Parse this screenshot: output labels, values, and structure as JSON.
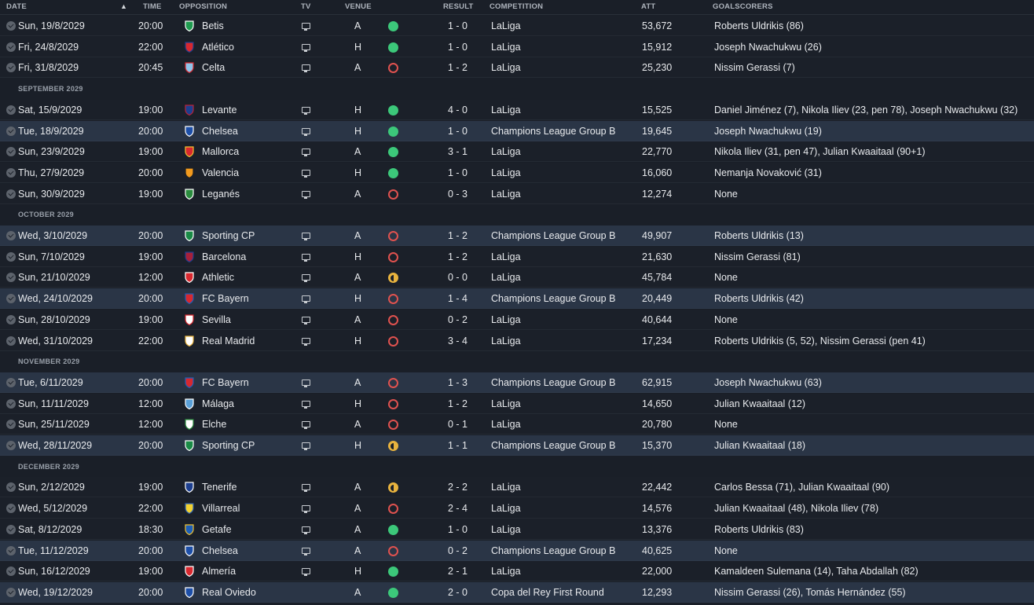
{
  "headers": {
    "date": "DATE",
    "time": "TIME",
    "opposition": "OPPOSITION",
    "tv": "TV",
    "venue": "VENUE",
    "result": "RESULT",
    "competition": "COMPETITION",
    "att": "ATT",
    "goalscorers": "GOALSCORERS"
  },
  "colors": {
    "win": "#3cc87a",
    "loss": "#e0524f",
    "draw": "#e8b33e",
    "highlight_row": "#2a3546"
  },
  "items": [
    {
      "kind": "match",
      "date": "Sun, 19/8/2029",
      "time": "20:00",
      "opp": "Betis",
      "badge": "betis-crest",
      "venue": "A",
      "outcome": "win",
      "result": "1 - 0",
      "comp": "LaLiga",
      "att": "53,672",
      "scorers": "Roberts Uldrikis (86)",
      "highlight": false
    },
    {
      "kind": "match",
      "date": "Fri, 24/8/2029",
      "time": "22:00",
      "opp": "Atlético",
      "badge": "atletico-crest",
      "venue": "H",
      "outcome": "win",
      "result": "1 - 0",
      "comp": "LaLiga",
      "att": "15,912",
      "scorers": "Joseph Nwachukwu (26)",
      "highlight": false
    },
    {
      "kind": "match",
      "date": "Fri, 31/8/2029",
      "time": "20:45",
      "opp": "Celta",
      "badge": "celta-crest",
      "venue": "A",
      "outcome": "loss",
      "result": "1 - 2",
      "comp": "LaLiga",
      "att": "25,230",
      "scorers": "Nissim Gerassi (7)",
      "highlight": false
    },
    {
      "kind": "month",
      "label": "SEPTEMBER 2029"
    },
    {
      "kind": "match",
      "date": "Sat, 15/9/2029",
      "time": "19:00",
      "opp": "Levante",
      "badge": "levante-crest",
      "venue": "H",
      "outcome": "win",
      "result": "4 - 0",
      "comp": "LaLiga",
      "att": "15,525",
      "scorers": "Daniel Jiménez (7), Nikola Iliev (23, pen 78), Joseph Nwachukwu (32)",
      "highlight": false
    },
    {
      "kind": "match",
      "date": "Tue, 18/9/2029",
      "time": "20:00",
      "opp": "Chelsea",
      "badge": "chelsea-crest",
      "venue": "H",
      "outcome": "win",
      "result": "1 - 0",
      "comp": "Champions League Group B",
      "att": "19,645",
      "scorers": "Joseph Nwachukwu (19)",
      "highlight": true
    },
    {
      "kind": "match",
      "date": "Sun, 23/9/2029",
      "time": "19:00",
      "opp": "Mallorca",
      "badge": "mallorca-crest",
      "venue": "A",
      "outcome": "win",
      "result": "3 - 1",
      "comp": "LaLiga",
      "att": "22,770",
      "scorers": "Nikola Iliev (31, pen 47), Julian Kwaaitaal (90+1)",
      "highlight": false
    },
    {
      "kind": "match",
      "date": "Thu, 27/9/2029",
      "time": "20:00",
      "opp": "Valencia",
      "badge": "valencia-crest",
      "venue": "H",
      "outcome": "win",
      "result": "1 - 0",
      "comp": "LaLiga",
      "att": "16,060",
      "scorers": "Nemanja Novaković (31)",
      "highlight": false
    },
    {
      "kind": "match",
      "date": "Sun, 30/9/2029",
      "time": "19:00",
      "opp": "Leganés",
      "badge": "leganes-crest",
      "venue": "A",
      "outcome": "loss",
      "result": "0 - 3",
      "comp": "LaLiga",
      "att": "12,274",
      "scorers": "None",
      "highlight": false
    },
    {
      "kind": "month",
      "label": "OCTOBER 2029"
    },
    {
      "kind": "match",
      "date": "Wed, 3/10/2029",
      "time": "20:00",
      "opp": "Sporting CP",
      "badge": "sporting-crest",
      "venue": "A",
      "outcome": "loss",
      "result": "1 - 2",
      "comp": "Champions League Group B",
      "att": "49,907",
      "scorers": "Roberts Uldrikis (13)",
      "highlight": true
    },
    {
      "kind": "match",
      "date": "Sun, 7/10/2029",
      "time": "19:00",
      "opp": "Barcelona",
      "badge": "barcelona-crest",
      "venue": "H",
      "outcome": "loss",
      "result": "1 - 2",
      "comp": "LaLiga",
      "att": "21,630",
      "scorers": "Nissim Gerassi (81)",
      "highlight": false
    },
    {
      "kind": "match",
      "date": "Sun, 21/10/2029",
      "time": "12:00",
      "opp": "Athletic",
      "badge": "athletic-crest",
      "venue": "A",
      "outcome": "draw",
      "result": "0 - 0",
      "comp": "LaLiga",
      "att": "45,784",
      "scorers": "None",
      "highlight": false
    },
    {
      "kind": "match",
      "date": "Wed, 24/10/2029",
      "time": "20:00",
      "opp": "FC Bayern",
      "badge": "bayern-crest",
      "venue": "H",
      "outcome": "loss",
      "result": "1 - 4",
      "comp": "Champions League Group B",
      "att": "20,449",
      "scorers": "Roberts Uldrikis (42)",
      "highlight": true
    },
    {
      "kind": "match",
      "date": "Sun, 28/10/2029",
      "time": "19:00",
      "opp": "Sevilla",
      "badge": "sevilla-crest",
      "venue": "A",
      "outcome": "loss",
      "result": "0 - 2",
      "comp": "LaLiga",
      "att": "40,644",
      "scorers": "None",
      "highlight": false
    },
    {
      "kind": "match",
      "date": "Wed, 31/10/2029",
      "time": "22:00",
      "opp": "Real Madrid",
      "badge": "real-madrid-crest",
      "venue": "H",
      "outcome": "loss",
      "result": "3 - 4",
      "comp": "LaLiga",
      "att": "17,234",
      "scorers": "Roberts Uldrikis (5, 52), Nissim Gerassi (pen 41)",
      "highlight": false
    },
    {
      "kind": "month",
      "label": "NOVEMBER 2029"
    },
    {
      "kind": "match",
      "date": "Tue, 6/11/2029",
      "time": "20:00",
      "opp": "FC Bayern",
      "badge": "bayern-crest",
      "venue": "A",
      "outcome": "loss",
      "result": "1 - 3",
      "comp": "Champions League Group B",
      "att": "62,915",
      "scorers": "Joseph Nwachukwu (63)",
      "highlight": true
    },
    {
      "kind": "match",
      "date": "Sun, 11/11/2029",
      "time": "12:00",
      "opp": "Málaga",
      "badge": "malaga-crest",
      "venue": "H",
      "outcome": "loss",
      "result": "1 - 2",
      "comp": "LaLiga",
      "att": "14,650",
      "scorers": "Julian Kwaaitaal (12)",
      "highlight": false
    },
    {
      "kind": "match",
      "date": "Sun, 25/11/2029",
      "time": "12:00",
      "opp": "Elche",
      "badge": "elche-crest",
      "venue": "A",
      "outcome": "loss",
      "result": "0 - 1",
      "comp": "LaLiga",
      "att": "20,780",
      "scorers": "None",
      "highlight": false
    },
    {
      "kind": "match",
      "date": "Wed, 28/11/2029",
      "time": "20:00",
      "opp": "Sporting CP",
      "badge": "sporting-crest",
      "venue": "H",
      "outcome": "draw",
      "result": "1 - 1",
      "comp": "Champions League Group B",
      "att": "15,370",
      "scorers": "Julian Kwaaitaal (18)",
      "highlight": true
    },
    {
      "kind": "month",
      "label": "DECEMBER 2029"
    },
    {
      "kind": "match",
      "date": "Sun, 2/12/2029",
      "time": "19:00",
      "opp": "Tenerife",
      "badge": "tenerife-crest",
      "venue": "A",
      "outcome": "draw",
      "result": "2 - 2",
      "comp": "LaLiga",
      "att": "22,442",
      "scorers": "Carlos Bessa (71), Julian Kwaaitaal (90)",
      "highlight": false
    },
    {
      "kind": "match",
      "date": "Wed, 5/12/2029",
      "time": "22:00",
      "opp": "Villarreal",
      "badge": "villarreal-crest",
      "venue": "A",
      "outcome": "loss",
      "result": "2 - 4",
      "comp": "LaLiga",
      "att": "14,576",
      "scorers": "Julian Kwaaitaal (48), Nikola Iliev (78)",
      "highlight": false
    },
    {
      "kind": "match",
      "date": "Sat, 8/12/2029",
      "time": "18:30",
      "opp": "Getafe",
      "badge": "getafe-crest",
      "venue": "A",
      "outcome": "win",
      "result": "1 - 0",
      "comp": "LaLiga",
      "att": "13,376",
      "scorers": "Roberts Uldrikis (83)",
      "highlight": false
    },
    {
      "kind": "match",
      "date": "Tue, 11/12/2029",
      "time": "20:00",
      "opp": "Chelsea",
      "badge": "chelsea-crest",
      "venue": "A",
      "outcome": "loss",
      "result": "0 - 2",
      "comp": "Champions League Group B",
      "att": "40,625",
      "scorers": "None",
      "highlight": true
    },
    {
      "kind": "match",
      "date": "Sun, 16/12/2029",
      "time": "19:00",
      "opp": "Almería",
      "badge": "almeria-crest",
      "venue": "H",
      "outcome": "win",
      "result": "2 - 1",
      "comp": "LaLiga",
      "att": "22,000",
      "scorers": "Kamaldeen Sulemana (14), Taha Abdallah (82)",
      "highlight": false
    },
    {
      "kind": "match",
      "date": "Wed, 19/12/2029",
      "time": "20:00",
      "opp": "Real Oviedo",
      "badge": "oviedo-crest",
      "venue": "A",
      "outcome": "win",
      "result": "2 - 0",
      "comp": "Copa del Rey First Round",
      "att": "12,293",
      "scorers": "Nissim Gerassi (26), Tomás Hernández (55)",
      "highlight": true,
      "no_tv": true
    }
  ]
}
